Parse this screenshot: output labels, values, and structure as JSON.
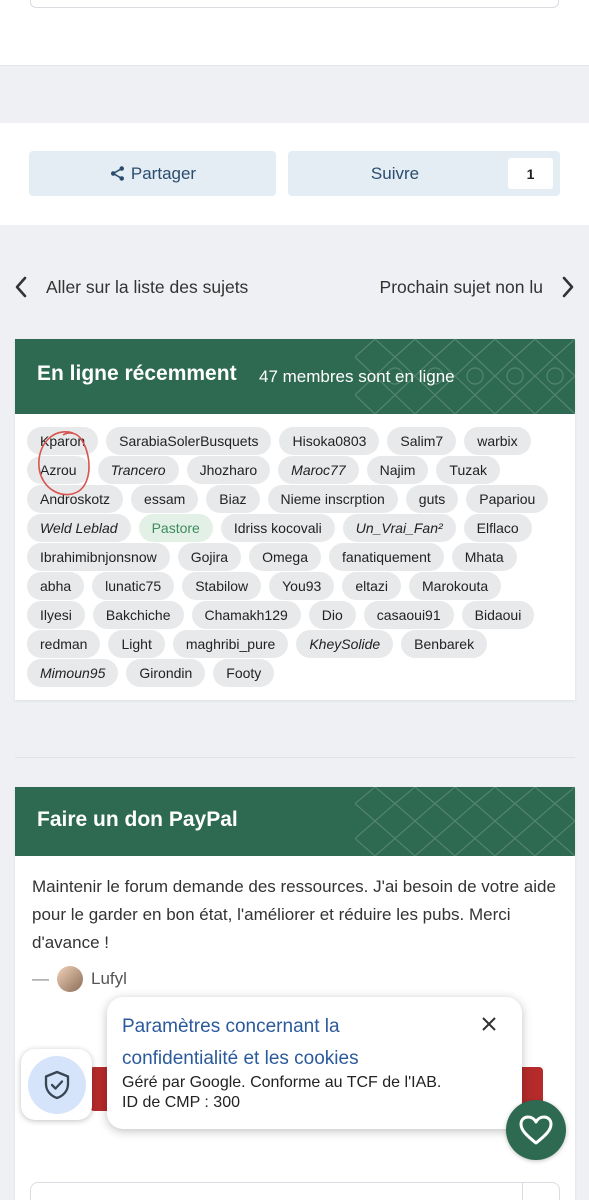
{
  "actions": {
    "share_label": "Partager",
    "follow_label": "Suivre",
    "follow_count": "1"
  },
  "navigation": {
    "prev_label": "Aller sur la liste des sujets",
    "next_label": "Prochain sujet non lu"
  },
  "online": {
    "title": "En ligne récemment",
    "subtitle": "47 membres sont en ligne",
    "members": [
      {
        "name": "Kparon",
        "style": "normal"
      },
      {
        "name": "SarabiaSolerBusquets",
        "style": "normal"
      },
      {
        "name": "Hisoka0803",
        "style": "normal"
      },
      {
        "name": "Salim7",
        "style": "normal"
      },
      {
        "name": "warbix",
        "style": "normal"
      },
      {
        "name": "Azrou",
        "style": "normal"
      },
      {
        "name": "Trancero",
        "style": "italic"
      },
      {
        "name": "Jhozharo",
        "style": "normal"
      },
      {
        "name": "Maroc77",
        "style": "italic"
      },
      {
        "name": "Najim",
        "style": "normal"
      },
      {
        "name": "Tuzak",
        "style": "normal"
      },
      {
        "name": "Androskotz",
        "style": "normal"
      },
      {
        "name": "essam",
        "style": "normal"
      },
      {
        "name": "Biaz",
        "style": "normal"
      },
      {
        "name": "Nieme inscrption",
        "style": "normal"
      },
      {
        "name": "guts",
        "style": "normal"
      },
      {
        "name": "Papariou",
        "style": "normal"
      },
      {
        "name": "Weld Leblad",
        "style": "italic"
      },
      {
        "name": "Pastore",
        "style": "green"
      },
      {
        "name": "Idriss kocovali",
        "style": "normal"
      },
      {
        "name": "Un_Vrai_Fan²",
        "style": "italic"
      },
      {
        "name": "Elflaco",
        "style": "normal"
      },
      {
        "name": "Ibrahimibnjonsnow",
        "style": "normal"
      },
      {
        "name": "Gojira",
        "style": "normal"
      },
      {
        "name": "Omega",
        "style": "normal"
      },
      {
        "name": "fanatiquement",
        "style": "normal"
      },
      {
        "name": "Mhata",
        "style": "normal"
      },
      {
        "name": "abha",
        "style": "normal"
      },
      {
        "name": "lunatic75",
        "style": "normal"
      },
      {
        "name": "Stabilow",
        "style": "normal"
      },
      {
        "name": "You93",
        "style": "normal"
      },
      {
        "name": "eltazi",
        "style": "normal"
      },
      {
        "name": "Marokouta",
        "style": "normal"
      },
      {
        "name": "Ilyesi",
        "style": "normal"
      },
      {
        "name": "Bakchiche",
        "style": "normal"
      },
      {
        "name": "Chamakh129",
        "style": "normal"
      },
      {
        "name": "Dio",
        "style": "normal"
      },
      {
        "name": "casaoui91",
        "style": "normal"
      },
      {
        "name": "Bidaoui",
        "style": "normal"
      },
      {
        "name": "redman",
        "style": "normal"
      },
      {
        "name": "Light",
        "style": "normal"
      },
      {
        "name": "maghribi_pure",
        "style": "normal"
      },
      {
        "name": "KheySolide",
        "style": "italic"
      },
      {
        "name": "Benbarek",
        "style": "normal"
      },
      {
        "name": "Mimoun95",
        "style": "italic"
      },
      {
        "name": "Girondin",
        "style": "normal"
      },
      {
        "name": "Footy",
        "style": "normal"
      }
    ]
  },
  "paypal": {
    "title": "Faire un don PayPal",
    "message": "Maintenir le forum demande des ressources. J'ai besoin de votre aide pour le garder en bon état, l'améliorer et réduire les pubs. Merci d'avance !",
    "signature_dash": "—",
    "author": "Lufyl"
  },
  "consent_popup": {
    "title": "Paramètres concernant la confidentialité et les cookies",
    "description": "Géré par Google. Conforme au TCF de l'IAB. ID de CMP : 300"
  },
  "colors": {
    "header_green": "#2e6a52",
    "button_bg": "#e4ecf4",
    "donate_red": "#b52b2b",
    "popup_title_blue": "#2b5a9c"
  }
}
